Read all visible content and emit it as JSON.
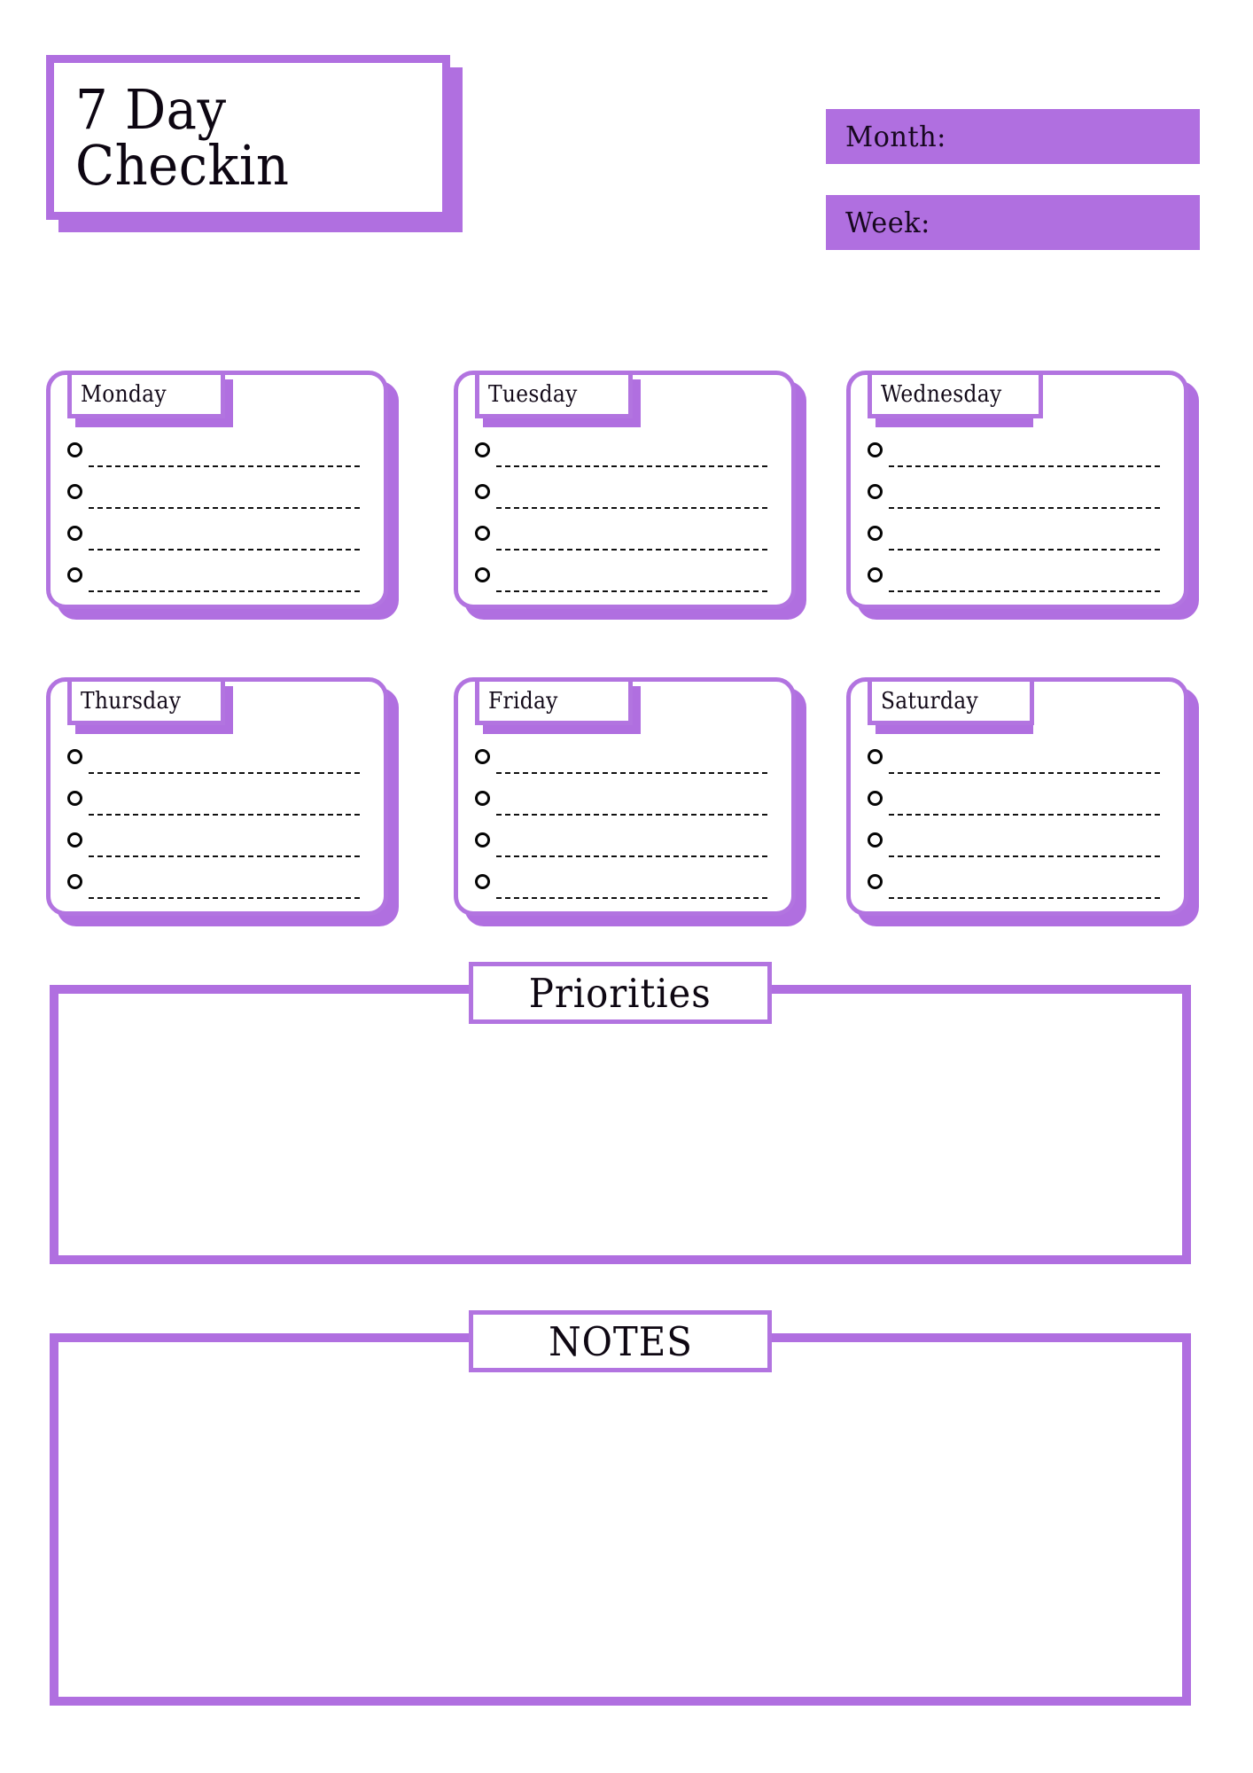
{
  "theme": {
    "accent": "#b06fe0",
    "accent_border": "#b274e0",
    "ink": "#0d0612",
    "paper": "#ffffff"
  },
  "header": {
    "title_line1": "7 Day",
    "title_line2": "Checkin",
    "fields": [
      {
        "label": "Month:"
      },
      {
        "label": "Week:"
      }
    ]
  },
  "days": [
    {
      "label": "Monday",
      "rows": [
        "",
        "",
        "",
        ""
      ]
    },
    {
      "label": "Tuesday",
      "rows": [
        "",
        "",
        "",
        ""
      ]
    },
    {
      "label": "Wednesday",
      "rows": [
        "",
        "",
        "",
        ""
      ]
    },
    {
      "label": "Thursday",
      "rows": [
        "",
        "",
        "",
        ""
      ]
    },
    {
      "label": "Friday",
      "rows": [
        "",
        "",
        "",
        ""
      ]
    },
    {
      "label": "Saturday",
      "rows": [
        "",
        "",
        "",
        ""
      ]
    }
  ],
  "sections": [
    {
      "title": "Priorities",
      "content": ""
    },
    {
      "title": "NOTES",
      "content": ""
    }
  ]
}
